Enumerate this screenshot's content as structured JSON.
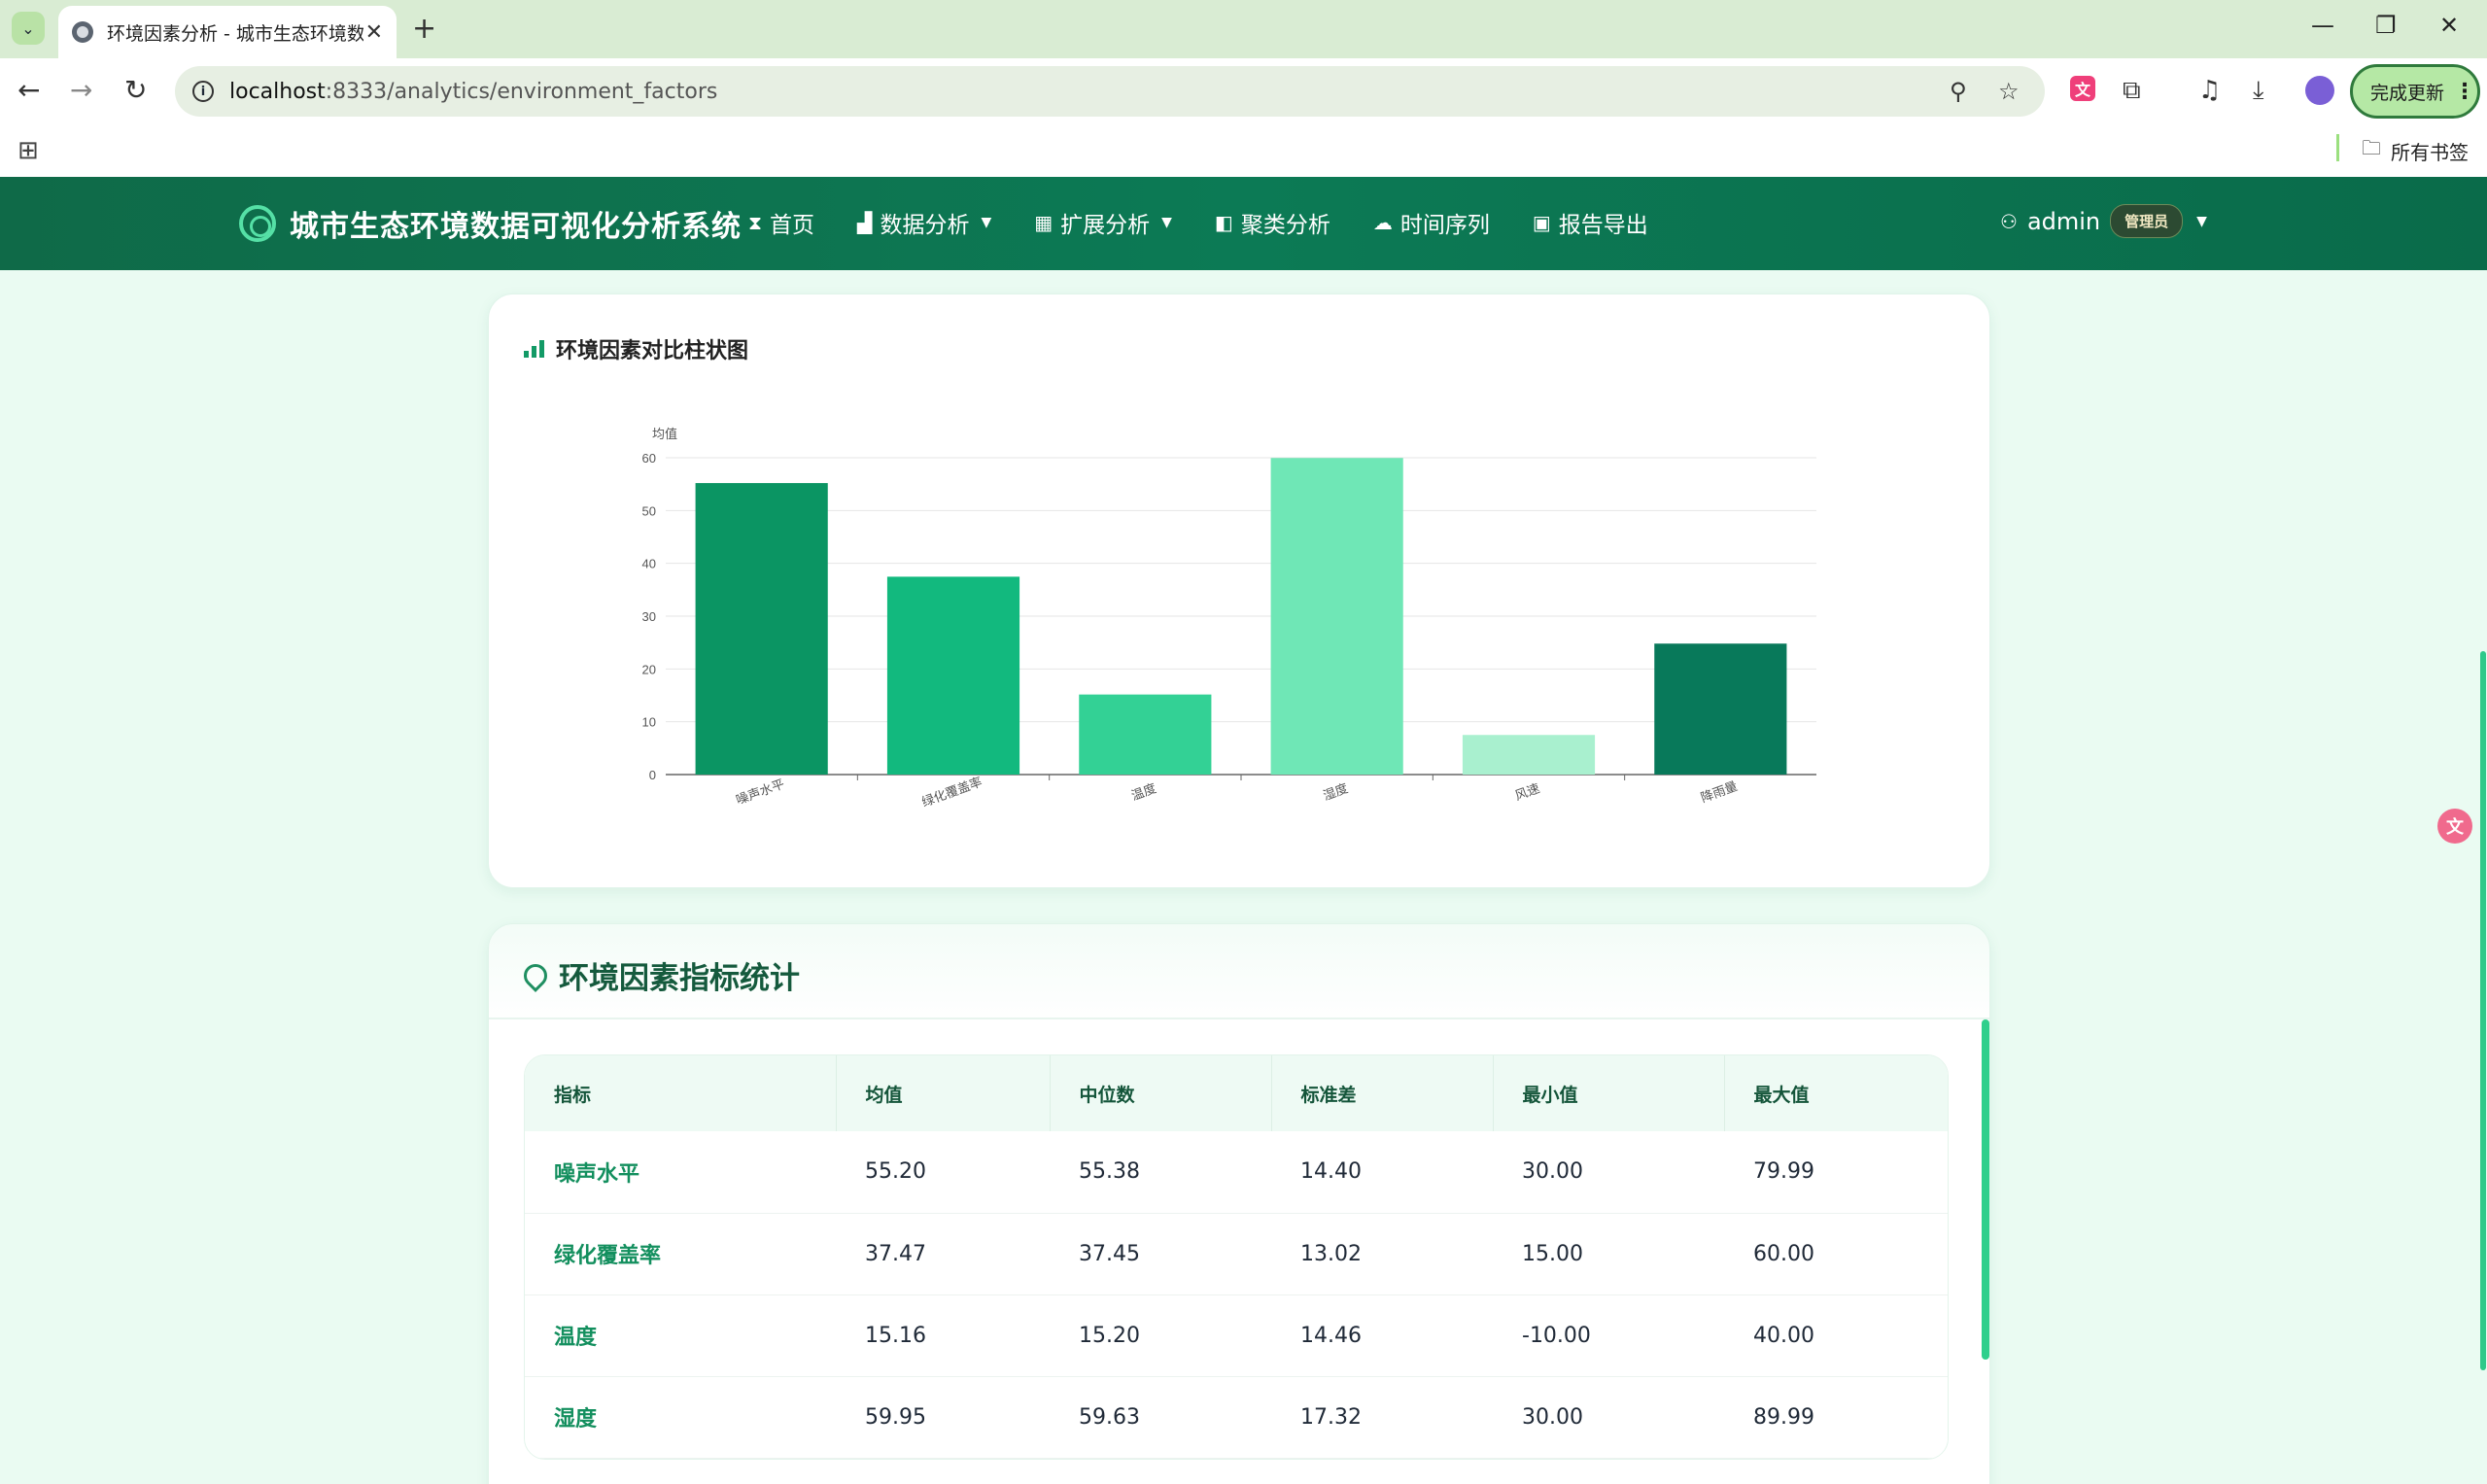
{
  "browser": {
    "tab_title": "环境因素分析 - 城市生态环境数",
    "url_host": "localhost",
    "url_path": ":8333/analytics/environment_factors",
    "update_label": "完成更新",
    "bookmarks_label": "所有书签"
  },
  "app": {
    "brand": "城市生态环境数据可视化分析系统",
    "nav": [
      {
        "label": "首页",
        "icon": "hourglass-icon"
      },
      {
        "label": "数据分析",
        "icon": "bar-chart-icon"
      },
      {
        "label": "扩展分析",
        "icon": "grid-icon"
      },
      {
        "label": "聚类分析",
        "icon": "panel-icon"
      },
      {
        "label": "时间序列",
        "icon": "cloud-icon"
      },
      {
        "label": "报告导出",
        "icon": "file-icon"
      }
    ],
    "user": "admin",
    "role": "管理员"
  },
  "chart_card": {
    "title": "环境因素对比柱状图"
  },
  "chart_data": {
    "type": "bar",
    "categories": [
      "噪声水平",
      "绿化覆盖率",
      "温度",
      "湿度",
      "风速",
      "降雨量"
    ],
    "values": [
      55.2,
      37.47,
      15.16,
      59.95,
      7.5,
      24.8
    ],
    "ylabel": "均值",
    "ylim": [
      0,
      60
    ],
    "yticks": [
      0,
      10,
      20,
      30,
      40,
      50,
      60
    ],
    "colors": [
      "#0b9563",
      "#12b97e",
      "#33d195",
      "#6fe7b6",
      "#a9f0cf",
      "#08795a"
    ],
    "grid": true
  },
  "stats": {
    "title": "环境因素指标统计",
    "columns": [
      "指标",
      "均值",
      "中位数",
      "标准差",
      "最小值",
      "最大值"
    ],
    "rows": [
      [
        "噪声水平",
        "55.20",
        "55.38",
        "14.40",
        "30.00",
        "79.99"
      ],
      [
        "绿化覆盖率",
        "37.47",
        "37.45",
        "13.02",
        "15.00",
        "60.00"
      ],
      [
        "温度",
        "15.16",
        "15.20",
        "14.46",
        "-10.00",
        "40.00"
      ],
      [
        "湿度",
        "59.95",
        "59.63",
        "17.32",
        "30.00",
        "89.99"
      ]
    ]
  }
}
